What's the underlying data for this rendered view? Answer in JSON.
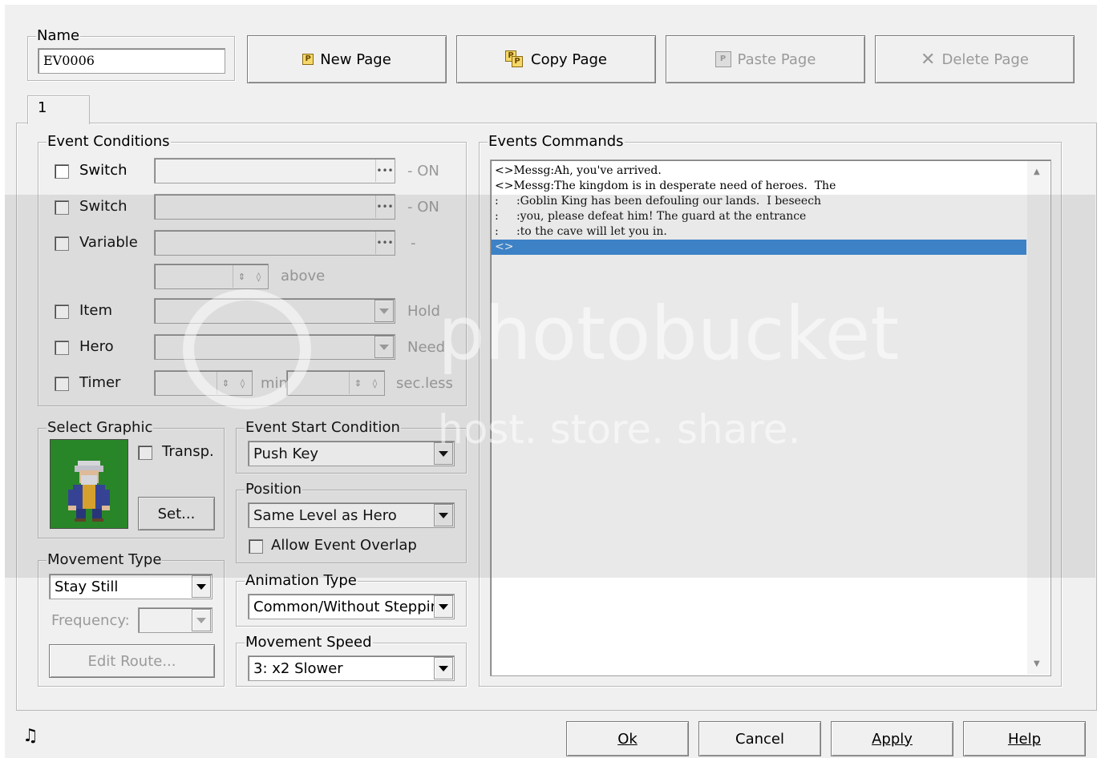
{
  "name_group": {
    "label": "Name",
    "value": "EV0006"
  },
  "toolbar": {
    "new_page": "New Page",
    "copy_page": "Copy Page",
    "paste_page": "Paste Page",
    "delete_page": "Delete Page"
  },
  "tabs": [
    {
      "label": "1"
    }
  ],
  "event_conditions": {
    "title": "Event Conditions",
    "switch1": {
      "label": "Switch",
      "suffix": "- ON",
      "checked": false
    },
    "switch2": {
      "label": "Switch",
      "suffix": "- ON",
      "checked": false
    },
    "variable": {
      "label": "Variable",
      "suffix": "-",
      "checked": false
    },
    "variable_above": "above",
    "item": {
      "label": "Item",
      "suffix": "Hold",
      "checked": false
    },
    "hero": {
      "label": "Hero",
      "suffix": "Need",
      "checked": false
    },
    "timer": {
      "label": "Timer",
      "min_label": "min",
      "sec_label": "sec.less",
      "checked": false
    }
  },
  "select_graphic": {
    "title": "Select Graphic",
    "transp_label": "Transp.",
    "set_button": "Set...",
    "bg_color": "#1a8a1a"
  },
  "movement_type": {
    "title": "Movement Type",
    "value": "Stay Still",
    "frequency_label": "Frequency:",
    "edit_route": "Edit Route..."
  },
  "event_start_condition": {
    "title": "Event Start Condition",
    "value": "Push Key"
  },
  "position": {
    "title": "Position",
    "value": "Same Level as Hero",
    "allow_overlap": "Allow Event Overlap"
  },
  "animation_type": {
    "title": "Animation Type",
    "value": "Common/Without Stepping"
  },
  "movement_speed": {
    "title": "Movement Speed",
    "value": "3: x2 Slower"
  },
  "events_commands": {
    "title": "Events Commands",
    "lines": [
      "<>Messg:Ah, you've arrived.",
      "<>Messg:The kingdom is in desperate need of heroes.  The",
      ":     :Goblin King has been defouling our lands.  I beseech",
      ":     :you, please defeat him! The guard at the entrance",
      ":     :to the cave will let you in.",
      "<>"
    ],
    "selected_index": 5,
    "selection_color": "#3385d6"
  },
  "footer": {
    "ok": "Ok",
    "cancel": "Cancel",
    "apply": "Apply",
    "help": "Help"
  },
  "watermark": {
    "brand": "photobucket",
    "tagline": "host. store. share."
  }
}
